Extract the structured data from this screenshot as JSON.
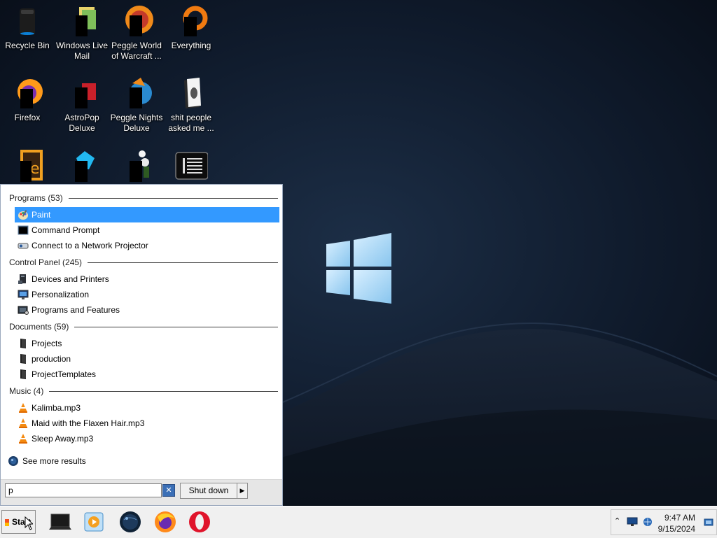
{
  "desktop": {
    "icons": [
      {
        "name": "recycle-bin-icon",
        "label": "Recycle Bin"
      },
      {
        "name": "windows-live-mail-icon",
        "label": "Windows Live Mail"
      },
      {
        "name": "peggle-world-of-warcraft-icon",
        "label": "Peggle World of Warcraft ..."
      },
      {
        "name": "everything-icon",
        "label": "Everything"
      },
      {
        "name": "firefox-icon",
        "label": "Firefox"
      },
      {
        "name": "astropop-deluxe-icon",
        "label": "AstroPop Deluxe"
      },
      {
        "name": "peggle-nights-deluxe-icon",
        "label": "Peggle Nights Deluxe"
      },
      {
        "name": "folder-icon",
        "label": "shit people asked me ..."
      },
      {
        "name": "adobe-app-icon",
        "label": ""
      },
      {
        "name": "gem-app-icon",
        "label": ""
      },
      {
        "name": "flower-app-icon",
        "label": ""
      },
      {
        "name": "text-list-app-icon",
        "label": ""
      }
    ]
  },
  "start_menu": {
    "groups": [
      {
        "header": "Programs (53)",
        "items": [
          {
            "label": "Paint",
            "icon": "paint-icon",
            "selected": true
          },
          {
            "label": "Command Prompt",
            "icon": "command-prompt-icon"
          },
          {
            "label": "Connect to a Network Projector",
            "icon": "network-projector-icon"
          }
        ]
      },
      {
        "header": "Control Panel (245)",
        "items": [
          {
            "label": "Devices and Printers",
            "icon": "devices-printers-icon"
          },
          {
            "label": "Personalization",
            "icon": "personalization-icon"
          },
          {
            "label": "Programs and Features",
            "icon": "programs-features-icon"
          }
        ]
      },
      {
        "header": "Documents (59)",
        "items": [
          {
            "label": "Projects",
            "icon": "document-icon"
          },
          {
            "label": "production",
            "icon": "document-icon"
          },
          {
            "label": "ProjectTemplates",
            "icon": "document-icon"
          }
        ]
      },
      {
        "header": "Music (4)",
        "items": [
          {
            "label": "Kalimba.mp3",
            "icon": "vlc-icon"
          },
          {
            "label": "Maid with the Flaxen Hair.mp3",
            "icon": "vlc-icon"
          },
          {
            "label": "Sleep Away.mp3",
            "icon": "vlc-icon"
          }
        ]
      }
    ],
    "see_more": "See more results",
    "search_value": "p",
    "shutdown_label": "Shut down",
    "shutdown_arrow": "▶",
    "clear_glyph": "✕"
  },
  "taskbar": {
    "start_label": "Start",
    "apps": [
      "laptop-icon",
      "media-player-icon",
      "globe-icon",
      "firefox-icon",
      "opera-icon"
    ],
    "tray_icons": [
      "chevron-up-icon",
      "monitor-icon",
      "network-icon"
    ],
    "time": "9:47 AM",
    "date": "9/15/2024"
  },
  "colors": {
    "selection": "#3399ff",
    "taskbar": "#f0f0f0",
    "wallpaper_dark": "#0b1421"
  }
}
